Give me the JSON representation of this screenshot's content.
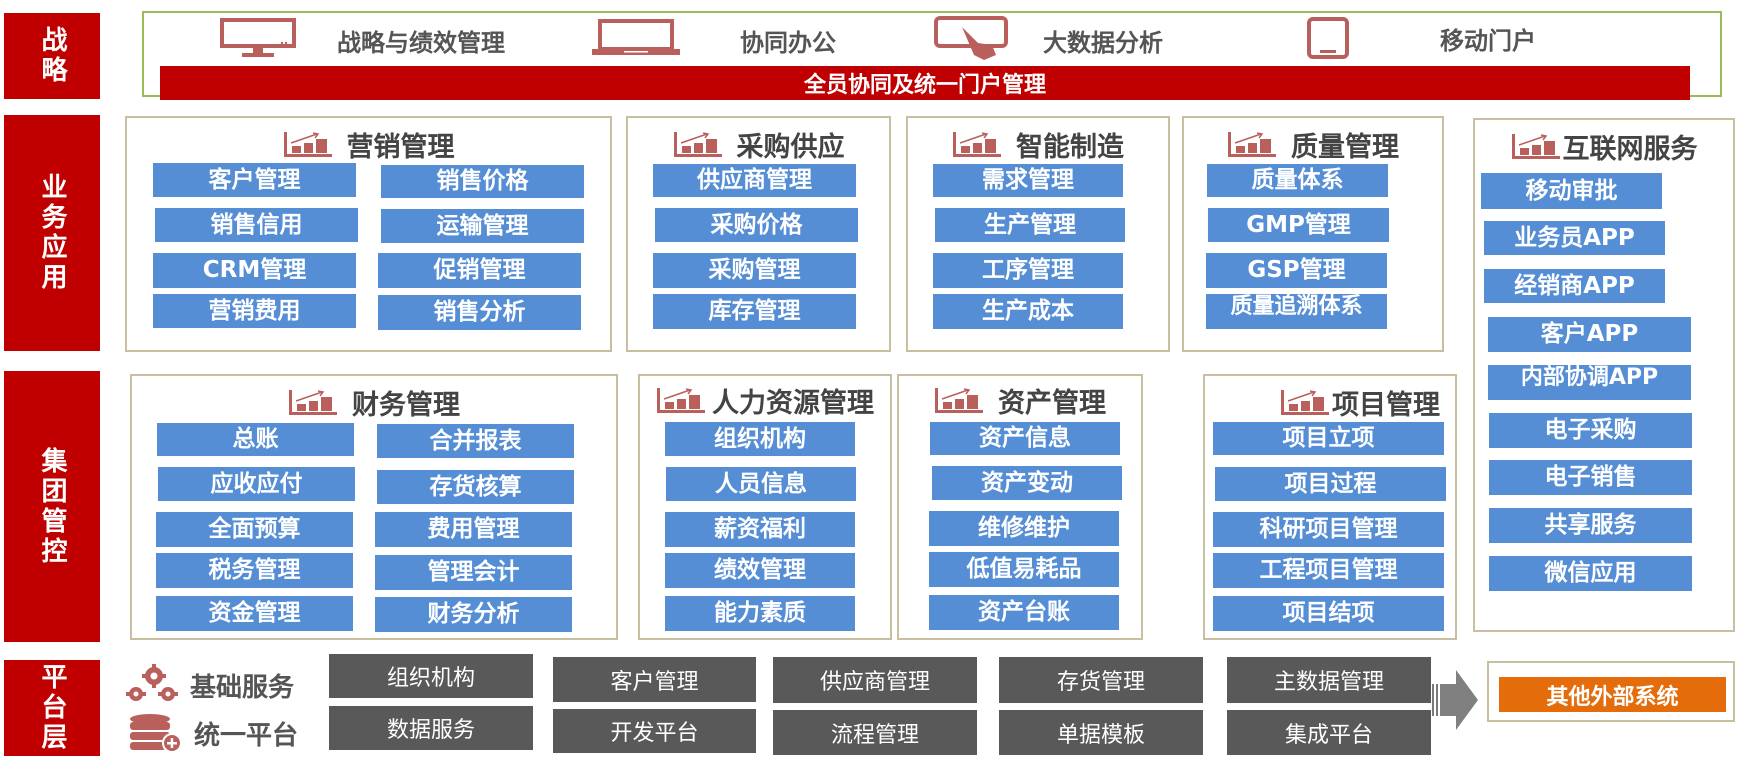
{
  "layers": {
    "strategy": "战略",
    "business": "业务应用",
    "group": "集团管控",
    "platform": "平台层"
  },
  "strategy": {
    "items": [
      {
        "icon": "monitor-icon",
        "label": "战略与绩效管理"
      },
      {
        "icon": "laptop-icon",
        "label": "协同办公"
      },
      {
        "icon": "touch-screen-icon",
        "label": "大数据分析"
      },
      {
        "icon": "tablet-icon",
        "label": "移动门户"
      }
    ],
    "banner": "全员协同及统一门户管理"
  },
  "business": {
    "marketing": {
      "title": "营销管理",
      "left": [
        "客户管理",
        "销售信用",
        "CRM管理",
        "营销费用"
      ],
      "right": [
        "销售价格",
        "运输管理",
        "促销管理",
        "销售分析"
      ]
    },
    "purchasing": {
      "title": "采购供应",
      "items": [
        "供应商管理",
        "采购价格",
        "采购管理",
        "库存管理"
      ]
    },
    "manufacturing": {
      "title": "智能制造",
      "items": [
        "需求管理",
        "生产管理",
        "工序管理",
        "生产成本"
      ]
    },
    "quality": {
      "title": "质量管理",
      "items": [
        "质量体系",
        "GMP管理",
        "GSP管理",
        "质量追溯体系"
      ]
    }
  },
  "internet": {
    "title": "互联网服务",
    "items": [
      "移动审批",
      "业务员APP",
      "经销商APP",
      "客户APP",
      "内部协调APP",
      "电子采购",
      "电子销售",
      "共享服务",
      "微信应用"
    ]
  },
  "group": {
    "finance": {
      "title": "财务管理",
      "left": [
        "总账",
        "应收应付",
        "全面预算",
        "税务管理",
        "资金管理"
      ],
      "right": [
        "合并报表",
        "存货核算",
        "费用管理",
        "管理会计",
        "财务分析"
      ]
    },
    "hr": {
      "title": "人力资源管理",
      "items": [
        "组织机构",
        "人员信息",
        "薪资福利",
        "绩效管理",
        "能力素质"
      ]
    },
    "assets": {
      "title": "资产管理",
      "items": [
        "资产信息",
        "资产变动",
        "维修维护",
        "低值易耗品",
        "资产台账"
      ]
    },
    "projects": {
      "title": "项目管理",
      "items": [
        "项目立项",
        "项目过程",
        "科研项目管理",
        "工程项目管理",
        "项目结项"
      ]
    }
  },
  "platform": {
    "basic_label": "基础服务",
    "unified_label": "统一平台",
    "row1": [
      "组织机构",
      "客户管理",
      "供应商管理",
      "存货管理",
      "主数据管理"
    ],
    "row2": [
      "数据服务",
      "开发平台",
      "流程管理",
      "单据模板",
      "集成平台"
    ],
    "external": "其他外部系统"
  },
  "colors": {
    "layer_red": "#c00000",
    "chip_blue": "#558ed5",
    "platform_gray": "#595959",
    "external_orange": "#e46c0a",
    "icon_rose": "#b9605c"
  }
}
